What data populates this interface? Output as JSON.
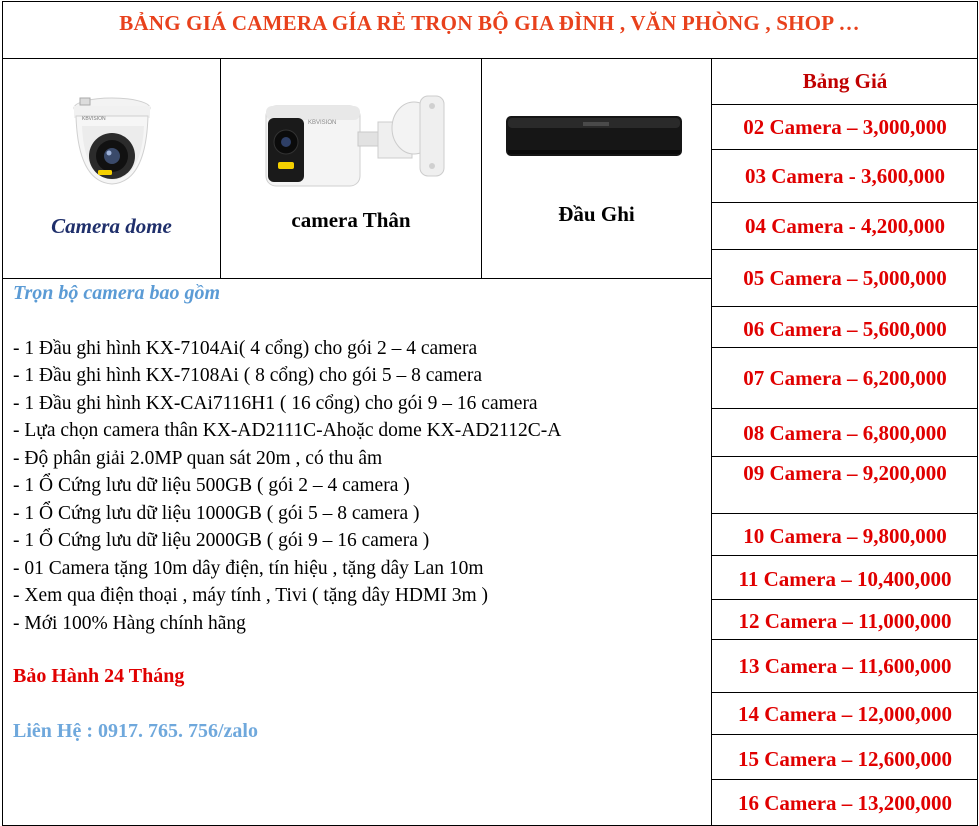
{
  "title": "BẢNG GIÁ CAMERA GÍA RẺ TRỌN BỘ GIA ĐÌNH , VĂN PHÒNG , SHOP …",
  "products": {
    "dome_label": "Camera dome",
    "bullet_label": "camera Thân",
    "recorder_label": "Đầu Ghi"
  },
  "camera_brand": "KBVISION",
  "prices": {
    "header": "Bảng Giá",
    "rows": [
      "02 Camera – 3,000,000",
      "03 Camera - 3,600,000",
      "04 Camera - 4,200,000",
      "05 Camera – 5,000,000",
      "06 Camera – 5,600,000",
      "07 Camera – 6,200,000",
      "08 Camera – 6,800,000",
      "09 Camera – 9,200,000",
      "10 Camera – 9,800,000",
      "11 Camera – 10,400,000",
      "12 Camera – 11,000,000",
      "13 Camera – 11,600,000",
      "14 Camera – 12,000,000",
      "15 Camera – 12,600,000",
      "16 Camera – 13,200,000"
    ]
  },
  "package": {
    "title": "Trọn bộ camera bao gồm",
    "items": [
      "- 1 Đầu ghi hình  KX-7104Ai( 4 cổng) cho gói 2 – 4 camera",
      "- 1 Đầu ghi hình  KX-7108Ai ( 8 cổng) cho gói 5 – 8 camera",
      "- 1 Đầu ghi hình  KX-CAi7116H1 ( 16 cổng) cho gói 9 – 16 camera",
      "- Lựa chọn camera  thân KX-AD2111C-Ahoặc dome KX-AD2112C-A",
      "- Độ phân giải 2.0MP quan sát 20m , có thu âm",
      "- 1 Ổ Cứng lưu dữ liệu 500GB  ( gói 2 – 4 camera )",
      "- 1 Ổ Cứng lưu dữ liệu 1000GB  ( gói 5 – 8 camera )",
      "- 1 Ổ Cứng lưu dữ liệu 2000GB  ( gói 9 – 16 camera )",
      "- 01 Camera tặng 10m dây điện, tín hiệu , tặng dây Lan 10m",
      "- Xem qua điện thoại , máy tính , Tivi ( tặng dây HDMI 3m )",
      "- Mới 100%  Hàng chính hãng"
    ],
    "warranty": "Bảo Hành 24 Tháng",
    "contact": "Liên Hệ : 0917. 765. 756/zalo"
  },
  "colors": {
    "title": "#e8411c",
    "price": "#e00000",
    "dome_label": "#1f2f6b",
    "package_title": "#5b9bd5",
    "contact": "#6fa8dc"
  }
}
